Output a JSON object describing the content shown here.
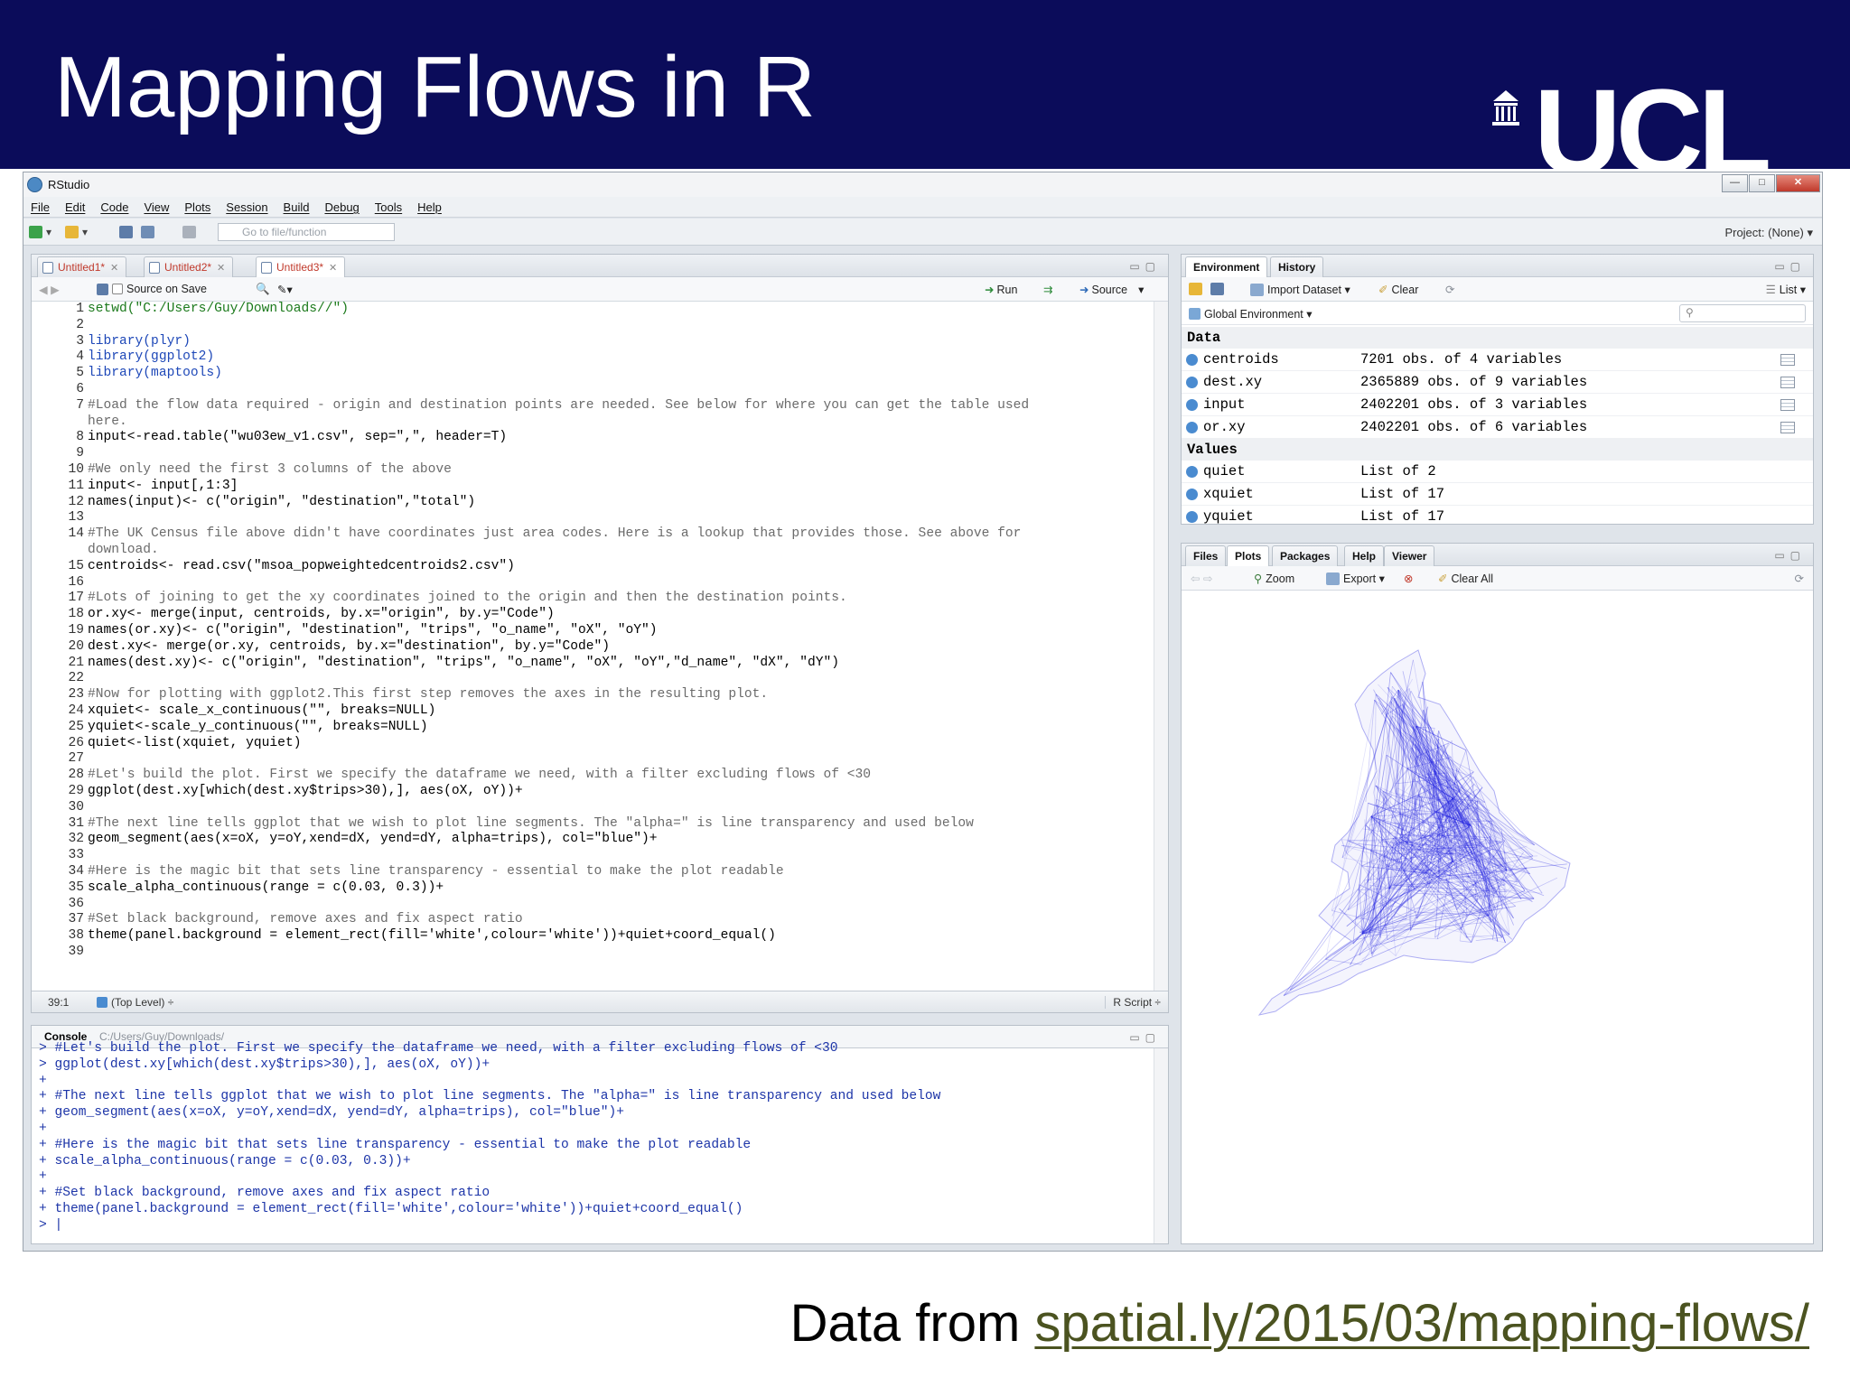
{
  "slide": {
    "title": "Mapping Flows in R",
    "logo_text": "UCL",
    "caption_prefix": "Data from ",
    "caption_link": "spatial.ly/2015/03/mapping-flows/"
  },
  "window": {
    "title": "RStudio",
    "controls": {
      "minimize": "—",
      "maximize": "□",
      "close": "✕"
    }
  },
  "menu": [
    "File",
    "Edit",
    "Code",
    "View",
    "Plots",
    "Session",
    "Build",
    "Debug",
    "Tools",
    "Help"
  ],
  "toolbar": {
    "goto_placeholder": "Go to file/function",
    "project": "Project: (None) ▾"
  },
  "editor": {
    "tabs": [
      "Untitled1*",
      "Untitled2*",
      "Untitled3*"
    ],
    "source_on_save": "Source on Save",
    "run": "Run",
    "source": "Source",
    "cursor_pos": "39:1",
    "scope": "(Top Level) ÷",
    "file_type": "R Script ÷"
  },
  "console": {
    "tab": "Console",
    "path": "C:/Users/Guy/Downloads/",
    "lines": [
      "> #Let's build the plot. First we specify the dataframe we need, with a filter excluding flows of <30",
      "> ggplot(dest.xy[which(dest.xy$trips>30),], aes(oX, oY))+",
      "+",
      "+ #The next line tells ggplot that we wish to plot line segments. The \"alpha=\" is line transparency and used below",
      "+ geom_segment(aes(x=oX, y=oY,xend=dX, yend=dY, alpha=trips), col=\"blue\")+",
      "+",
      "+ #Here is the magic bit that sets line transparency - essential to make the plot readable",
      "+ scale_alpha_continuous(range = c(0.03, 0.3))+",
      "+",
      "+ #Set black background, remove axes and fix aspect ratio",
      "+ theme(panel.background = element_rect(fill='white',colour='white'))+quiet+coord_equal()",
      "> |"
    ]
  },
  "environment": {
    "tabs": [
      "Environment",
      "History"
    ],
    "import": "Import Dataset ▾",
    "clear": "Clear",
    "list_toggle": "List ▾",
    "scope": "Global Environment ▾",
    "data_header": "Data",
    "values_header": "Values",
    "data": [
      {
        "name": "centroids",
        "value": "7201 obs. of 4 variables"
      },
      {
        "name": "dest.xy",
        "value": "2365889 obs. of 9 variables"
      },
      {
        "name": "input",
        "value": "2402201 obs. of 3 variables"
      },
      {
        "name": "or.xy",
        "value": "2402201 obs. of 6 variables"
      }
    ],
    "values": [
      {
        "name": "quiet",
        "value": "List of 2"
      },
      {
        "name": "xquiet",
        "value": "List of 17"
      },
      {
        "name": "yquiet",
        "value": "List of 17"
      }
    ]
  },
  "plots": {
    "tabs": [
      "Files",
      "Plots",
      "Packages",
      "Help",
      "Viewer"
    ],
    "zoom": "Zoom",
    "export": "Export ▾",
    "clear_all": "Clear All",
    "line_color": "#1f1fe0"
  }
}
